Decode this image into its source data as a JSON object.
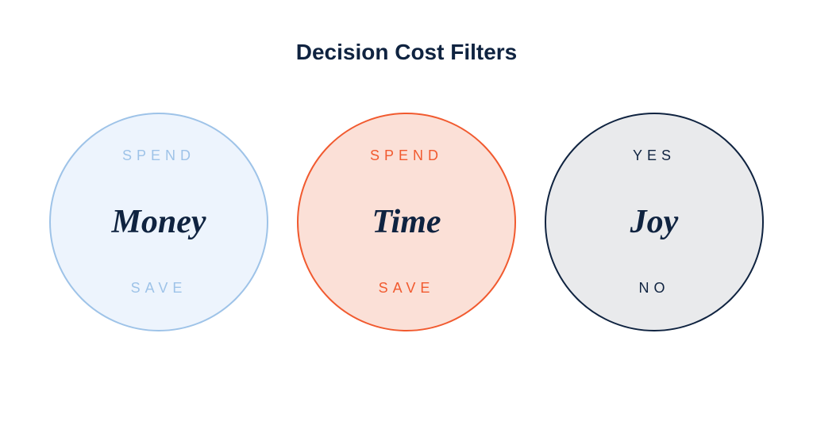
{
  "title": "Decision Cost Filters",
  "filters": [
    {
      "id": "money",
      "top_label": "SPEND",
      "center_label": "Money",
      "bottom_label": "SAVE",
      "fill_color": "#edf4fd",
      "border_color": "#9ec3e8",
      "label_color": "#9ec3e8",
      "center_color": "#0f2340"
    },
    {
      "id": "time",
      "top_label": "SPEND",
      "center_label": "Time",
      "bottom_label": "SAVE",
      "fill_color": "#fbe0d7",
      "border_color": "#f15a2f",
      "label_color": "#f15a2f",
      "center_color": "#0f2340"
    },
    {
      "id": "joy",
      "top_label": "YES",
      "center_label": "Joy",
      "bottom_label": "NO",
      "fill_color": "#e9eaec",
      "border_color": "#0f2340",
      "label_color": "#0f2340",
      "center_color": "#0f2340"
    }
  ]
}
